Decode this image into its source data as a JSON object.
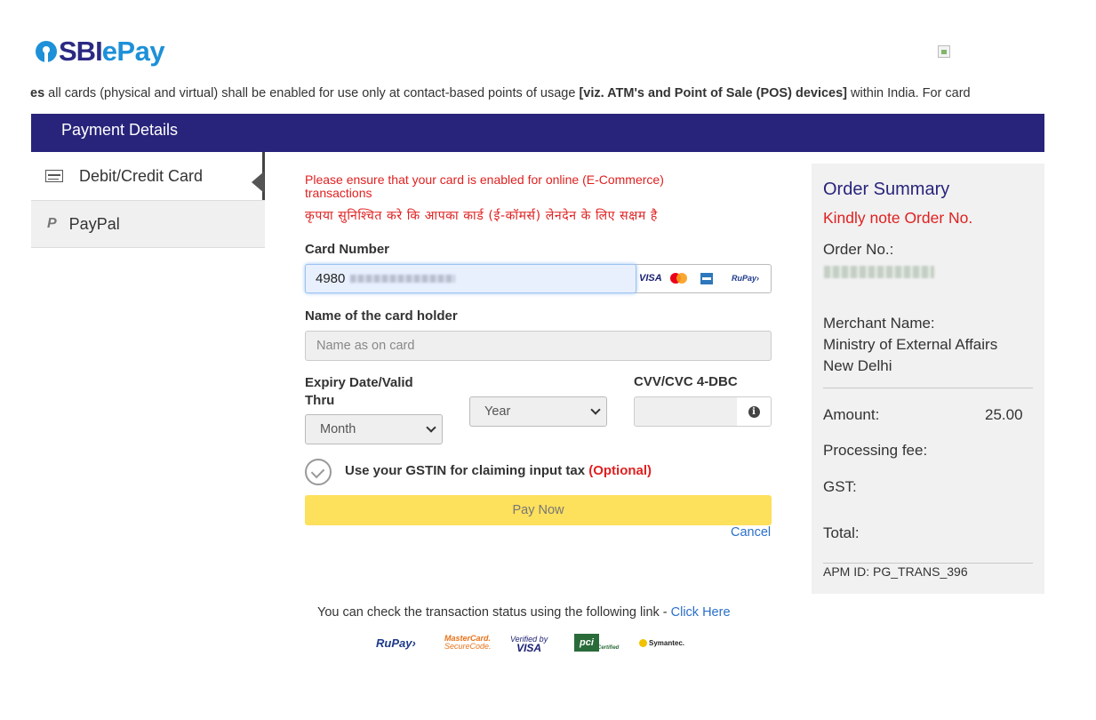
{
  "brand": {
    "logo_part1": "SBI",
    "logo_part2": "ePay",
    "primary_color": "#28247b",
    "accent_color": "#1e90d8"
  },
  "notice": {
    "lead": "es",
    "text": " all cards (physical and virtual) shall be enabled for use only at contact-based points of usage ",
    "bold": "[viz. ATM's and Point of Sale (POS) devices]",
    "tail": " within India. For card"
  },
  "header": {
    "title": "Payment Details"
  },
  "tabs": [
    {
      "label": "Debit/Credit Card",
      "icon": "credit-card-icon",
      "active": true
    },
    {
      "label": "PayPal",
      "icon": "paypal-icon",
      "active": false
    }
  ],
  "form": {
    "warning_en": "Please ensure that your card is enabled for online (E-Commerce) transactions",
    "warning_hi": "कृपया सुनिश्चित करे कि आपका कार्ड (ई-कॉमर्स) लेनदेन के लिए सक्षम है",
    "card_number_label": "Card Number",
    "card_number_value": "4980",
    "card_brands": [
      "VISA",
      "MasterCard",
      "Amex",
      "RuPay›"
    ],
    "name_label": "Name of the card holder",
    "name_placeholder": "Name as on card",
    "expiry_label": "Expiry Date/Valid Thru",
    "month_value": "Month",
    "year_value": "Year",
    "cvv_label": "CVV/CVC 4-DBC",
    "info_glyph": "i",
    "gst_text": "Use your GSTIN for claiming input tax",
    "gst_optional": "(Optional)",
    "pay_button": "Pay Now",
    "cancel_link": "Cancel",
    "pay_button_color": "#fde05c",
    "warning_color": "#e02020"
  },
  "summary": {
    "title": "Order Summary",
    "note": "Kindly note Order No.",
    "order_label": "Order No.:",
    "merchant_label": "Merchant Name:",
    "merchant_name": "Ministry of External Affairs New Delhi",
    "amount_label": "Amount:",
    "amount_value": "25.00",
    "fee_label": "Processing fee:",
    "gst_label": "GST:",
    "total_label": "Total:",
    "apm_id": "APM ID: PG_TRANS_396"
  },
  "footer": {
    "status_text": "You can check the transaction status using the following link - ",
    "status_link": "Click Here",
    "rupay": "RuPay›",
    "mastercard_line1": "MasterCard.",
    "mastercard_line2": "SecureCode.",
    "visa_line1": "Verified by",
    "visa_line2": "VISA",
    "pci": "pci",
    "pci_sub": "Certified",
    "symantec": "Symantec."
  }
}
